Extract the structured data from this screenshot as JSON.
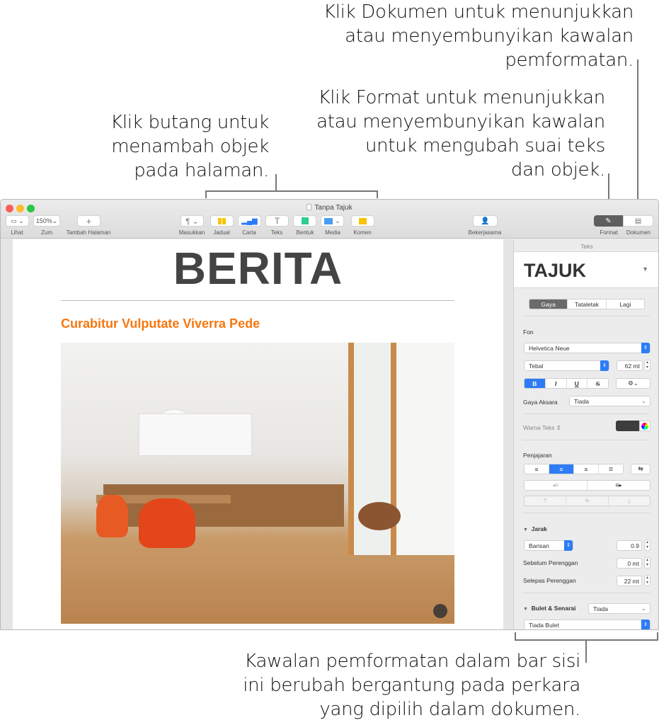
{
  "annotations": {
    "document": [
      "Klik Dokumen untuk menunjukkan",
      "atau menyembunyikan kawalan",
      "pemformatan."
    ],
    "format": [
      "Klik Format untuk menunjukkan",
      "atau menyembunyikan kawalan",
      "untuk mengubah suai teks",
      "dan objek."
    ],
    "buttons": [
      "Klik butang untuk",
      "menambah objek",
      "pada halaman."
    ],
    "sidebar": [
      "Kawalan pemformatan dalam bar sisi",
      "ini berubah bergantung pada perkara",
      "yang dipilih dalam dokumen."
    ]
  },
  "window": {
    "title": "Tanpa Tajuk"
  },
  "toolbar": {
    "view": "Lihat",
    "zoom": "Zum",
    "zoom_value": "150%",
    "add_page": "Tambah Halaman",
    "insert": "Masukkan",
    "table": "Jadual",
    "chart": "Carta",
    "text": "Teks",
    "shape": "Bentuk",
    "media": "Media",
    "comment": "Komen",
    "collaborate": "Bekerjasama",
    "format": "Format",
    "document": "Dokumen"
  },
  "page": {
    "heading": "BERITA",
    "subtitle": "Curabitur Vulputate Viverra Pede"
  },
  "sidebar": {
    "header": "Teks",
    "style_name": "TAJUK",
    "tabs": [
      "Gaya",
      "Tataletak",
      "Lagi"
    ],
    "font_label": "Fon",
    "font": "Helvetica Neue",
    "typeface": "Tebal",
    "size": "62 mt",
    "bius": [
      "B",
      "I",
      "U",
      "S"
    ],
    "char_style_label": "Gaya Aksara",
    "char_style": "Tiada",
    "text_color_label": "Warna Teks",
    "text_color": "#3d3d3d",
    "align_label": "Penjajaran",
    "spacing_label": "Jarak",
    "spacing_mode": "Barisan",
    "spacing_value": "0.9",
    "before_label": "Sebelum Perenggan",
    "before_value": "0 mt",
    "after_label": "Selepas Perenggan",
    "after_value": "22 mt",
    "bullets_label": "Bulet & Senarai",
    "bullets_value": "Tiada",
    "bullet_type": "Tiada Bulet"
  },
  "colors": {
    "accent": "#2d7cf6",
    "subtitle": "#f7770f"
  }
}
